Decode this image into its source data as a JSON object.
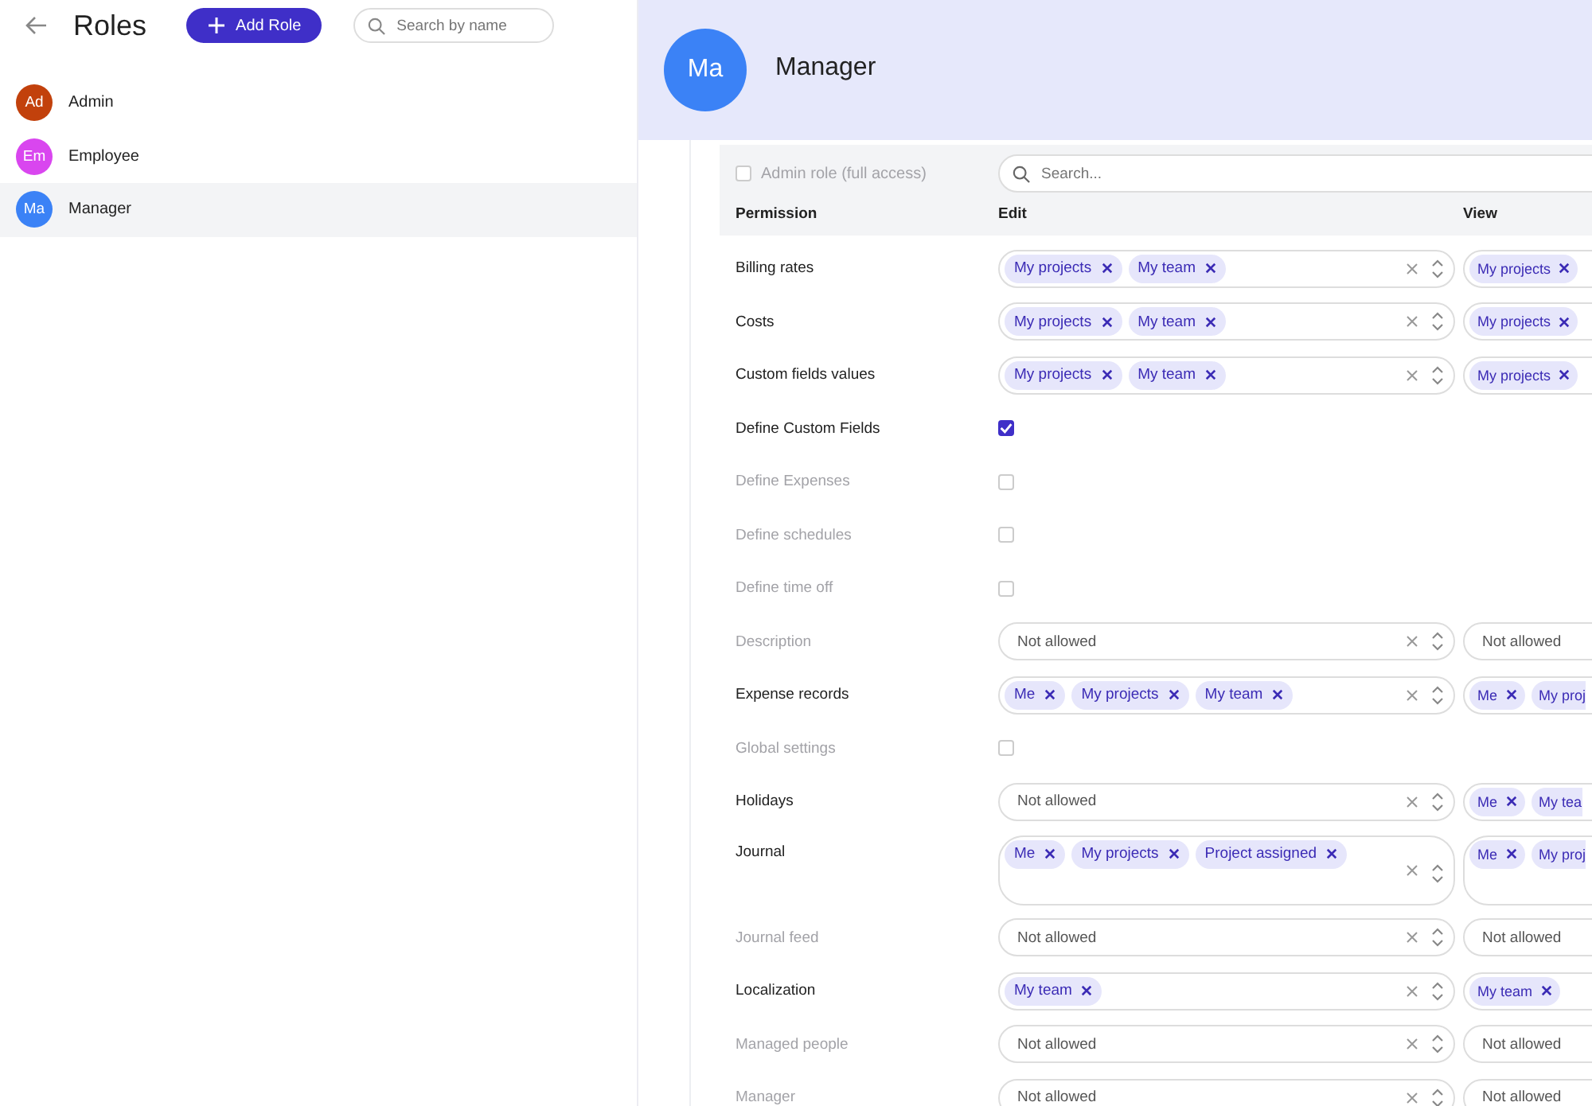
{
  "sidebar": {
    "title": "Roles",
    "add_button": "Add Role",
    "search": {
      "placeholder": "Search by name"
    },
    "roles": [
      {
        "initials": "Ad",
        "name": "Admin",
        "color": "#c2410c",
        "selected": false
      },
      {
        "initials": "Em",
        "name": "Employee",
        "color": "#d946ef",
        "selected": false
      },
      {
        "initials": "Ma",
        "name": "Manager",
        "color": "#3b82f6",
        "selected": true
      }
    ]
  },
  "header": {
    "initials": "Ma",
    "title": "Manager",
    "color": "#3b82f6"
  },
  "admin_role": {
    "label": "Admin role (full access)",
    "checked": false
  },
  "search": {
    "placeholder": "Search..."
  },
  "columns": [
    "Permission",
    "Edit",
    "View"
  ],
  "rows": [
    {
      "name": "Billing rates",
      "enabled": true,
      "kind": "select",
      "edit": {
        "chips": [
          {
            "label": "My projects",
            "removable": true
          },
          {
            "label": "My team",
            "removable": true
          }
        ]
      },
      "view": {
        "chips": [
          {
            "label": "My projects",
            "removable": true
          }
        ]
      }
    },
    {
      "name": "Costs",
      "enabled": true,
      "kind": "select",
      "edit": {
        "chips": [
          {
            "label": "My projects",
            "removable": true
          },
          {
            "label": "My team",
            "removable": true
          }
        ]
      },
      "view": {
        "chips": [
          {
            "label": "My projects",
            "removable": true
          }
        ]
      }
    },
    {
      "name": "Custom fields values",
      "enabled": true,
      "kind": "select",
      "edit": {
        "chips": [
          {
            "label": "My projects",
            "removable": true
          },
          {
            "label": "My team",
            "removable": true
          }
        ]
      },
      "view": {
        "chips": [
          {
            "label": "My projects",
            "removable": true
          }
        ]
      }
    },
    {
      "name": "Define Custom Fields",
      "enabled": true,
      "kind": "checkbox",
      "checked": true
    },
    {
      "name": "Define Expenses",
      "enabled": false,
      "kind": "checkbox",
      "checked": false
    },
    {
      "name": "Define schedules",
      "enabled": false,
      "kind": "checkbox",
      "checked": false
    },
    {
      "name": "Define time off",
      "enabled": false,
      "kind": "checkbox",
      "checked": false
    },
    {
      "name": "Description",
      "enabled": false,
      "kind": "select",
      "edit": {
        "value": "Not allowed"
      },
      "view": {
        "value": "Not allowed"
      }
    },
    {
      "name": "Expense records",
      "enabled": true,
      "kind": "select",
      "edit": {
        "chips": [
          {
            "label": "Me",
            "removable": true
          },
          {
            "label": "My projects",
            "removable": true
          },
          {
            "label": "My team",
            "removable": true
          }
        ]
      },
      "view": {
        "chips": [
          {
            "label": "Me",
            "removable": true
          },
          {
            "label": "My proj",
            "removable": false
          }
        ]
      }
    },
    {
      "name": "Global settings",
      "enabled": false,
      "kind": "checkbox",
      "checked": false
    },
    {
      "name": "Holidays",
      "enabled": true,
      "kind": "select",
      "edit": {
        "value": "Not allowed"
      },
      "view": {
        "chips": [
          {
            "label": "Me",
            "removable": true
          },
          {
            "label": "My tea",
            "removable": false
          }
        ]
      }
    },
    {
      "name": "Journal",
      "enabled": true,
      "kind": "select",
      "tall": true,
      "edit": {
        "chips": [
          {
            "label": "Me",
            "removable": true
          },
          {
            "label": "My projects",
            "removable": true
          },
          {
            "label": "Project assigned",
            "removable": true
          }
        ]
      },
      "view": {
        "chips": [
          {
            "label": "Me",
            "removable": true
          },
          {
            "label": "My proj",
            "removable": false
          }
        ]
      }
    },
    {
      "name": "Journal feed",
      "enabled": false,
      "kind": "select",
      "edit": {
        "value": "Not allowed"
      },
      "view": {
        "value": "Not allowed"
      }
    },
    {
      "name": "Localization",
      "enabled": true,
      "kind": "select",
      "edit": {
        "chips": [
          {
            "label": "My team",
            "removable": true
          }
        ]
      },
      "view": {
        "chips": [
          {
            "label": "My team",
            "removable": true
          }
        ]
      }
    },
    {
      "name": "Managed people",
      "enabled": false,
      "kind": "select",
      "edit": {
        "value": "Not allowed"
      },
      "view": {
        "value": "Not allowed"
      }
    },
    {
      "name": "Manager",
      "enabled": false,
      "kind": "select",
      "edit": {
        "value": "Not allowed"
      },
      "view": {
        "value": "Not allowed"
      }
    }
  ]
}
